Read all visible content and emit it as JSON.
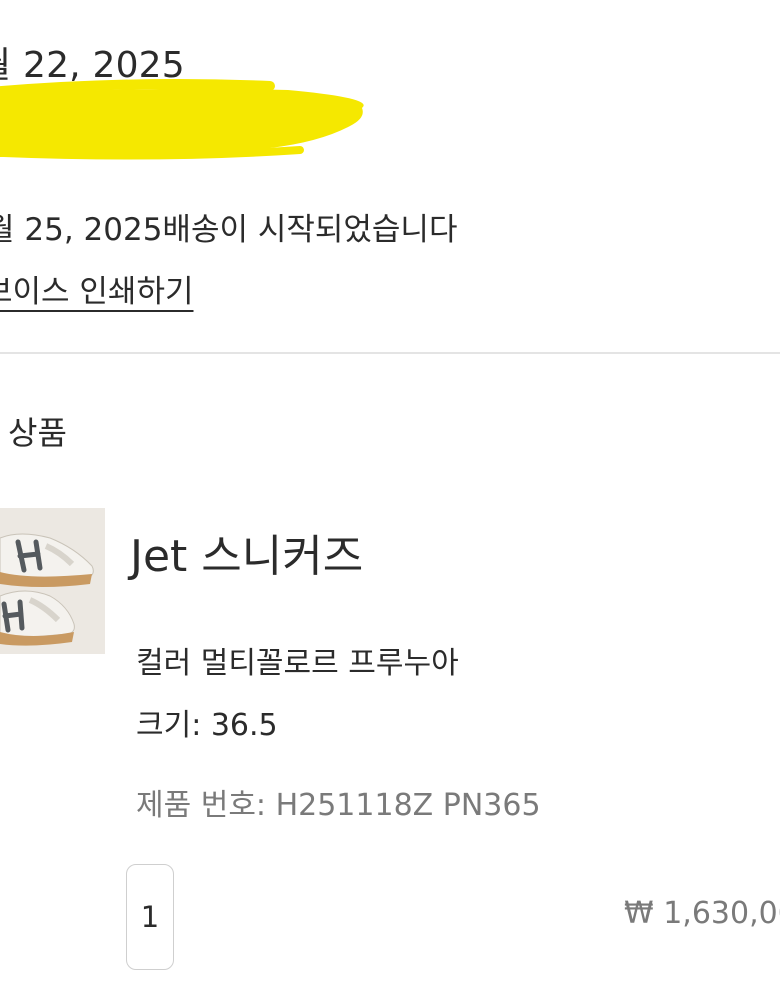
{
  "order": {
    "date_text": "월 22, 2025",
    "shipping_status": "월 25, 2025배송이 시작되었습니다",
    "print_invoice_label": "보이스 인쇄하기"
  },
  "items_section": {
    "title": "상품"
  },
  "product": {
    "name": "Jet 스니커즈",
    "color_text": "컬러 멀티꼴로르 프루누아",
    "size_text": "크기: 36.5",
    "number_text": "제품 번호: H251118Z PN365",
    "quantity": "1",
    "price": "₩ 1,630,00"
  },
  "colors": {
    "redaction_highlight": "#f5e800",
    "divider": "#e4e4e4",
    "text_primary": "#2b2b2b",
    "text_secondary": "#7a7a7a"
  }
}
